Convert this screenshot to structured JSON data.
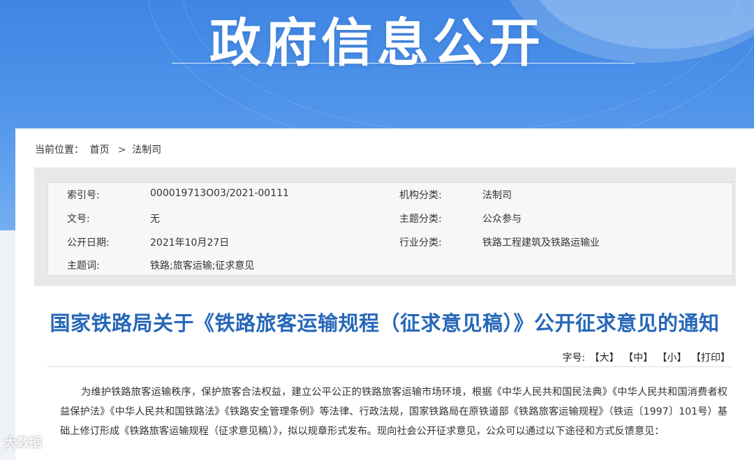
{
  "banner": {
    "title": "政府信息公开"
  },
  "breadcrumb": {
    "label": "当前位置：",
    "items": [
      "首页",
      "法制司"
    ],
    "separator": ">"
  },
  "info": {
    "rows": [
      {
        "label": "索引号:",
        "value": "000019713O03/2021-00111",
        "label2": "机构分类:",
        "value2": "法制司"
      },
      {
        "label": "文号:",
        "value": "无",
        "label2": "主题分类:",
        "value2": "公众参与"
      },
      {
        "label": "公开日期:",
        "value": "2021年10月27日",
        "label2": "行业分类:",
        "value2": "铁路工程建筑及铁路运输业"
      },
      {
        "label": "主题词:",
        "value": "铁路;旅客运输;征求意见",
        "label2": "",
        "value2": ""
      }
    ]
  },
  "document": {
    "title": "国家铁路局关于《铁路旅客运输规程（征求意见稿）》公开征求意见的通知",
    "font_label": "字号:",
    "font_large": "【大】",
    "font_medium": "【中】",
    "font_small": "【小】",
    "print": "【打印】",
    "body": "为维护铁路旅客运输秩序，保护旅客合法权益，建立公平公正的铁路旅客运输市场环境，根据《中华人民共和国民法典》《中华人民共和国消费者权益保护法》《中华人民共和国铁路法》《铁路安全管理条例》等法律、行政法规，国家铁路局在原铁道部《铁路旅客运输规程》（铁运〔1997〕101号）基础上修订形成《铁路旅客运输规程（征求意见稿）》，拟以规章形式发布。现向社会公开征求意见，公众可以通过以下途径和方式反馈意见："
  },
  "watermark": {
    "text": "大数据"
  },
  "colors": {
    "banner": "#4f93ea",
    "title": "#2667b8"
  }
}
